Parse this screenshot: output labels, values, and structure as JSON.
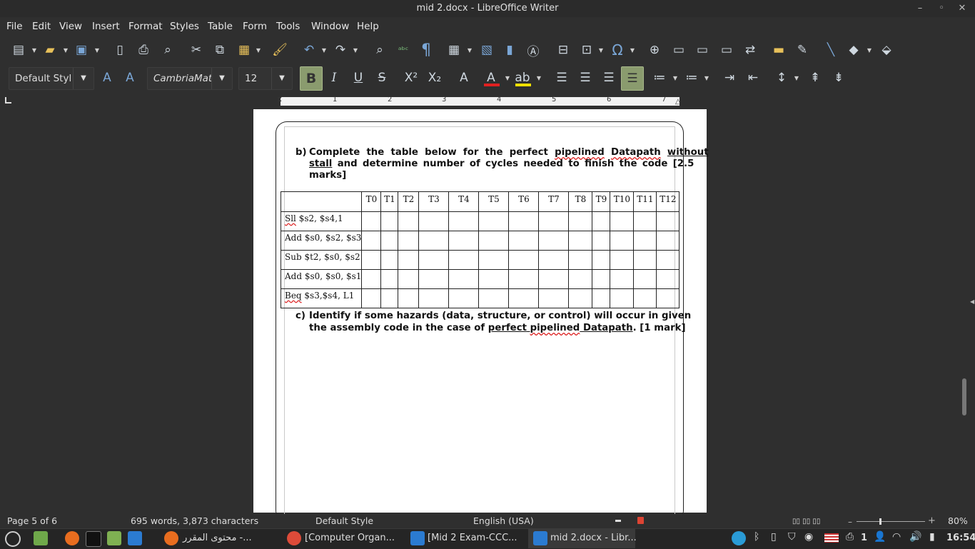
{
  "window": {
    "title": "mid 2.docx - LibreOffice Writer"
  },
  "menu": [
    "File",
    "Edit",
    "View",
    "Insert",
    "Format",
    "Styles",
    "Table",
    "Form",
    "Tools",
    "Window",
    "Help"
  ],
  "format_bar": {
    "paragraph_style": "Default Styl",
    "font_name": "CambriaMat",
    "font_size": "12"
  },
  "ruler": {
    "numbers": [
      "1",
      "2",
      "3",
      "4",
      "5",
      "6",
      "7"
    ]
  },
  "document": {
    "q_b": {
      "label": "b)",
      "line1_a": "Complete the table below for the perfect ",
      "line1_b": "pipelined",
      "line1_c": " ",
      "line1_d": "Datapath",
      "line1_e": " ",
      "line1_f": "without",
      "line2_a": "stall",
      "line2_b": " and determine number of cycles needed to finish the code [2.5",
      "line3": "marks]"
    },
    "table": {
      "headers": [
        "T0",
        "T1",
        "T2",
        "T3",
        "T4",
        "T5",
        "T6",
        "T7",
        "T8",
        "T9",
        "T10",
        "T11",
        "T12"
      ],
      "instructions": [
        {
          "a": "Sll",
          "b": " $s2, $s4,1"
        },
        {
          "a": "",
          "b": "Add $s0, $s2, $s3"
        },
        {
          "a": "",
          "b": "Sub $t2, $s0, $s2"
        },
        {
          "a": "",
          "b": "Add $s0, $s0, $s1"
        },
        {
          "a": "Beq",
          "b": " $s3,$s4, L1"
        }
      ]
    },
    "q_c": {
      "label": "c)",
      "line1": "Identify if some hazards (data, structure, or control) will occur in given",
      "line2_a": "the assembly code in the case of ",
      "line2_b": "perfect",
      "line2_c": " ",
      "line2_d": "pipelined",
      "line2_e": " Datapath",
      "line2_f": ". [1 mark]"
    }
  },
  "status": {
    "page": "Page 5 of 6",
    "words": "695 words, 3,873 characters",
    "style": "Default Style",
    "language": "English (USA)",
    "zoom": "80%"
  },
  "taskbar": {
    "items": [
      "محتوى المقرر -...",
      "[Computer Organ...",
      "[Mid 2 Exam-CCC...",
      "mid 2.docx - Libr..."
    ],
    "time": "16:54",
    "notif": "1"
  }
}
